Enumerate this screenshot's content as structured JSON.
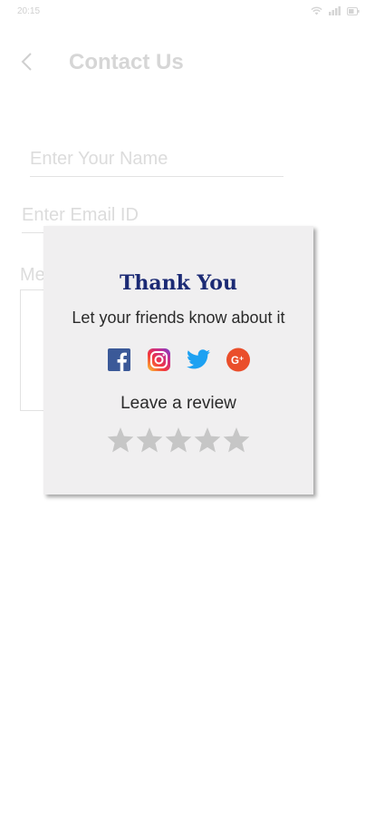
{
  "status_bar": {
    "time": "20:15",
    "icons": [
      "wifi-icon",
      "signal-icon",
      "battery-icon"
    ]
  },
  "header": {
    "back_icon": "chevron-left-icon",
    "title": "Contact Us"
  },
  "form": {
    "name_placeholder": "Enter Your Name",
    "email_placeholder": "Enter Email ID",
    "message_label": "Me"
  },
  "modal": {
    "title": "Thank You",
    "subtitle": "Let your friends know about it",
    "socials": [
      "facebook-icon",
      "instagram-icon",
      "twitter-icon",
      "google-plus-icon"
    ],
    "review_label": "Leave a review",
    "rating": {
      "value": 0,
      "max": 5
    }
  },
  "colors": {
    "title": "#1b2a74",
    "modal_bg": "#f0eff0",
    "star": "#c6c6c6",
    "facebook": "#3b5998",
    "twitter": "#1da1f2",
    "google_plus": "#ea4e2b"
  }
}
